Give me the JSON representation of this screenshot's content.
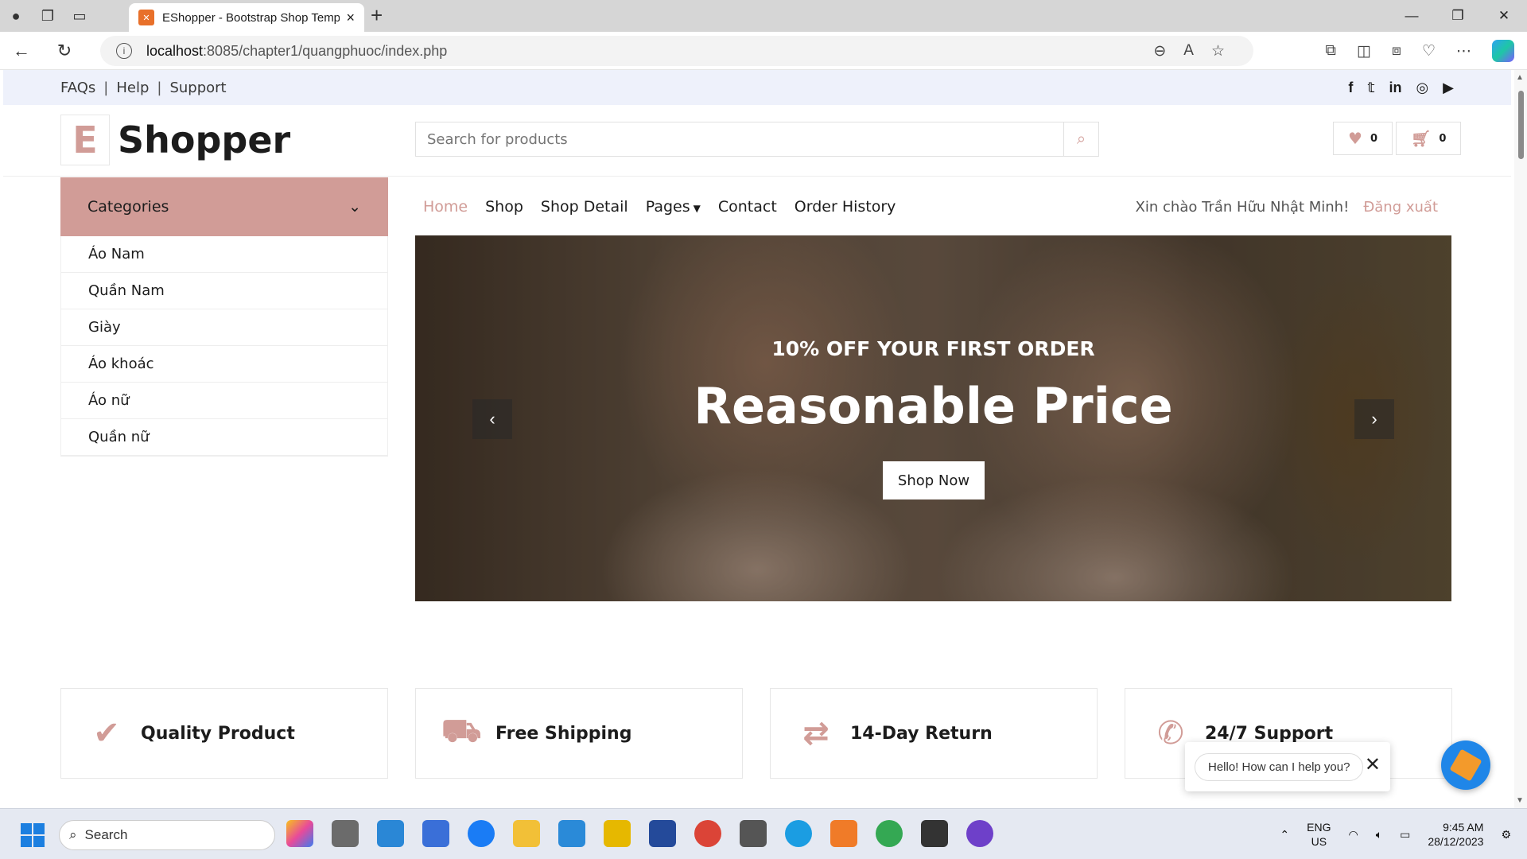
{
  "browser": {
    "tab_title": "EShopper - Bootstrap Shop Temp",
    "url_host": "localhost",
    "url_path": ":8085/chapter1/quangphuoc/index.php"
  },
  "topbar": {
    "links": [
      "FAQs",
      "Help",
      "Support"
    ]
  },
  "logo": {
    "letter": "E",
    "word": "Shopper"
  },
  "search": {
    "placeholder": "Search for products"
  },
  "header": {
    "wishlist_count": "0",
    "cart_count": "0"
  },
  "categories": {
    "title": "Categories",
    "items": [
      "Áo Nam",
      "Quần Nam",
      "Giày",
      "Áo khoác",
      "Áo nữ",
      "Quần nữ"
    ]
  },
  "nav": {
    "home": "Home",
    "shop": "Shop",
    "shop_detail": "Shop Detail",
    "pages": "Pages",
    "contact": "Contact",
    "order_history": "Order History",
    "greeting": "Xin chào Trần Hữu Nhật Minh!",
    "logout": "Đăng xuất"
  },
  "hero": {
    "subtitle": "10% OFF YOUR FIRST ORDER",
    "title": "Reasonable Price",
    "button": "Shop Now"
  },
  "features": [
    "Quality Product",
    "Free Shipping",
    "14-Day Return",
    "24/7 Support"
  ],
  "chat": {
    "message": "Hello! How can I help you?"
  },
  "taskbar": {
    "search": "Search",
    "lang": "ENG",
    "region": "US",
    "time": "9:45 AM",
    "date": "28/12/2023"
  },
  "colors": {
    "accent": "#d19c97",
    "topbar_bg": "#eef1fb"
  }
}
